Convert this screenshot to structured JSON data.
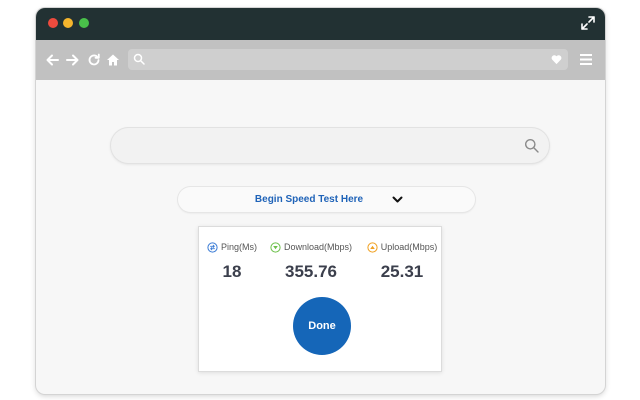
{
  "icons": {
    "expand": "expand-icon",
    "back": "arrow-left-icon",
    "forward": "arrow-right-icon",
    "reload": "reload-icon",
    "home": "home-icon",
    "url_search": "search-icon",
    "favorite": "heart-icon",
    "menu": "hamburger-menu-icon",
    "search": "search-icon",
    "dropdown": "chevron-down-icon"
  },
  "colors": {
    "titlebar": "#223133",
    "toolbar": "#c1c1c1",
    "accent": "#1566b8",
    "ping": "#3a7bd5",
    "download": "#6cc04a",
    "upload": "#f0a020"
  },
  "search": {
    "placeholder": ""
  },
  "speed_test": {
    "label": "Begin Speed Test Here"
  },
  "results": {
    "ping": {
      "label": "Ping(Ms)",
      "value": "18"
    },
    "download": {
      "label": "Download(Mbps)",
      "value": "355.76"
    },
    "upload": {
      "label": "Upload(Mbps)",
      "value": "25.31"
    }
  },
  "done_label": "Done"
}
